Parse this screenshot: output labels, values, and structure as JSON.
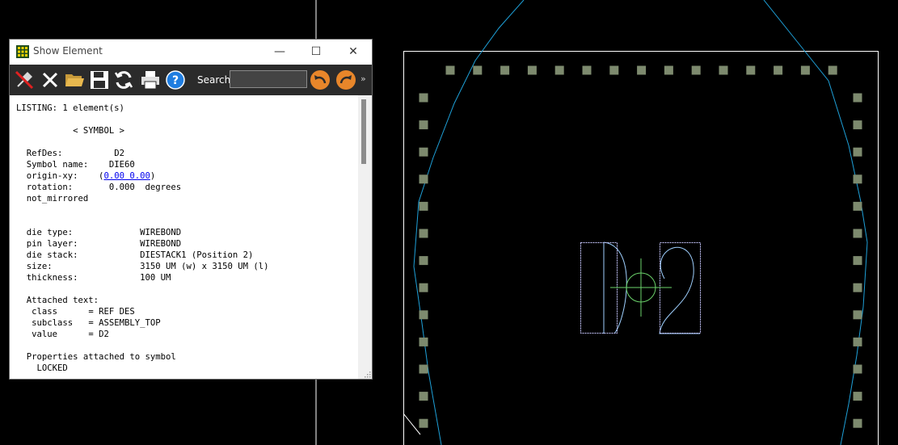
{
  "window": {
    "title": "Show Element",
    "min_glyph": "—",
    "max_glyph": "☐",
    "close_glyph": "✕"
  },
  "toolbar": {
    "icons": [
      "pin-icon",
      "close-x-icon",
      "folder-icon",
      "save-icon",
      "refresh-icon",
      "print-icon",
      "help-icon",
      "back-arrow-icon",
      "forward-arrow-icon"
    ],
    "search_label": "Search:",
    "search_value": "",
    "overflow_glyph": "»"
  },
  "listing": {
    "header": "LISTING: 1 element(s)",
    "symbol_header": "< SYMBOL >",
    "refdes_label": "RefDes:",
    "refdes_value": "D2",
    "symbol_name_label": "Symbol name:",
    "symbol_name_value": "DIE60",
    "origin_label": "origin-xy:",
    "origin_value": "0.00 0.00",
    "rotation_label": "rotation:",
    "rotation_value": "0.000",
    "rotation_unit": "degrees",
    "mirrored": "not_mirrored",
    "die_type_label": "die type:",
    "die_type_value": "WIREBOND",
    "pin_layer_label": "pin layer:",
    "pin_layer_value": "WIREBOND",
    "die_stack_label": "die stack:",
    "die_stack_value": "DIESTACK1 (Position 2)",
    "size_label": "size:",
    "size_value": "3150 UM (w) x 3150 UM (l)",
    "thickness_label": "thickness:",
    "thickness_value": "100 UM",
    "attached_text_label": "Attached text:",
    "class_label": "class",
    "class_value": "= REF DES",
    "subclass_label": "subclass",
    "subclass_value": "= ASSEMBLY_TOP",
    "value_label": "value",
    "value_value": "= D2",
    "properties_label": "Properties attached to symbol",
    "locked": "LOCKED"
  },
  "canvas": {
    "refdes_text": "D2",
    "colors": {
      "background": "#000000",
      "die_outline": "#ffffff",
      "boundary": "#1ea0d8",
      "pads": "#7d8a6e",
      "origin_marker": "#6bd36b",
      "refdes": "#9fd0ff"
    }
  }
}
